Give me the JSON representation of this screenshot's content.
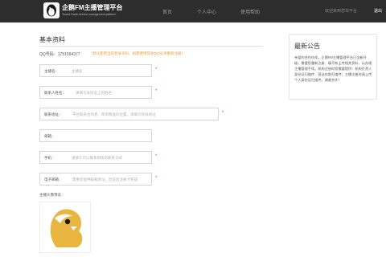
{
  "header": {
    "brand_title": "企鹅FM主播管理平台",
    "brand_subtitle": "Tecent Radio Anchor management platform",
    "nav": [
      {
        "label": "首页"
      },
      {
        "label": "个人中心"
      },
      {
        "label": "使用帮助"
      }
    ],
    "user_text": "欢迎来到您本平台",
    "logout_label": "退出"
  },
  "profile": {
    "section_title": "基本资料",
    "qq_text": "QQ号码：1751594377",
    "qq_warning": "默认使用当前登录号码，如需使用其他QQ号请重新注册！",
    "fields": [
      {
        "label": "主播名：",
        "placeholder": "主播名",
        "required": "*"
      },
      {
        "label": "联系人姓名：",
        "placeholder": "请填写身份证上的姓名",
        "required": "*"
      },
      {
        "label": "联系地址：",
        "placeholder": "平台联系合作者，简单精准的位置，请填写有效地址",
        "required": "*"
      },
      {
        "label": "邮箱：",
        "placeholder": "",
        "required": ""
      },
      {
        "label": "手机：",
        "placeholder": "请填写可以联系到您的联系方式",
        "required": "*"
      },
      {
        "label": "电子邮箱：",
        "placeholder": "需要您提供邮箱地址，验证后注册才完成",
        "required": "*"
      }
    ],
    "avatar_label": "主播头像预览："
  },
  "notice": {
    "title": "最新公告",
    "text": "亲爱的合作伙伴，企鹅FM主播管理平台已全新升级，需要您重新注册、填写和上传相关资料，以办理主播管理手续。机构注册时您需要提供：机构负责人身份证扫描件、营业执照扫描件；主播注册时请上传个人身份证扫描件。谢谢合作！"
  },
  "colors": {
    "topbar": "#2d2d2d",
    "warning": "#e8a03a",
    "required": "#e74c3c",
    "logo_gold": "#e7b540"
  },
  "icons": {
    "logo": "penguin-logo-icon",
    "avatar": "penguin-avatar-icon"
  }
}
